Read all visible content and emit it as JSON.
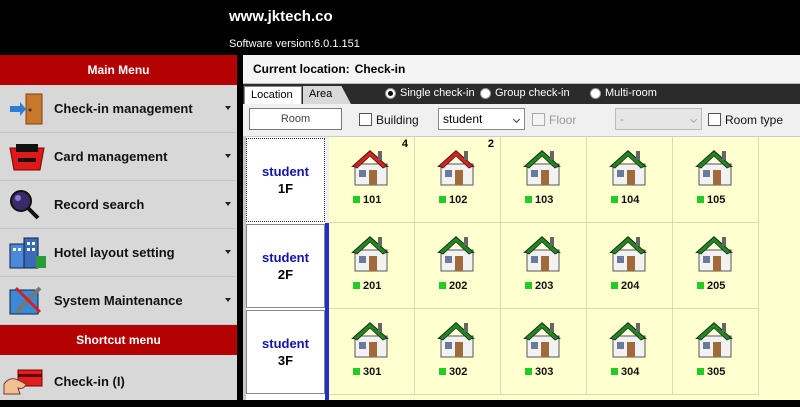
{
  "header": {
    "site": "www.jktech.co",
    "version": "Software version:6.0.1.151"
  },
  "sidebar": {
    "main_menu_title": "Main Menu",
    "items": [
      {
        "label": "Check-in management",
        "icon": "door-icon"
      },
      {
        "label": "Card management",
        "icon": "card-reader-icon"
      },
      {
        "label": "Record search",
        "icon": "magnifier-icon"
      },
      {
        "label": "Hotel layout setting",
        "icon": "building-icon"
      },
      {
        "label": "System Maintenance",
        "icon": "tools-icon"
      }
    ],
    "shortcut_title": "Shortcut menu",
    "shortcut_items": [
      {
        "label": "Check-in (I)",
        "icon": "hand-card-icon"
      }
    ]
  },
  "main": {
    "current_location_label": "Current location:",
    "current_location_value": "Check-in",
    "tabs": [
      {
        "label": "Location",
        "active": true
      },
      {
        "label": "Area",
        "active": false
      }
    ],
    "modes": [
      {
        "label": "Single check-in",
        "selected": true
      },
      {
        "label": "Group check-in",
        "selected": false
      },
      {
        "label": "Multi-room",
        "selected": false
      }
    ],
    "filters": {
      "room_placeholder": "Room",
      "building_label": "Building",
      "building_value": "student",
      "floor_label": "Floor",
      "floor_value": "-",
      "room_type_label": "Room type"
    },
    "floors": [
      {
        "name": "student",
        "floor": "1F",
        "rooms": [
          {
            "number": "101",
            "occupied": true,
            "count": "4"
          },
          {
            "number": "102",
            "occupied": true,
            "count": "2"
          },
          {
            "number": "103",
            "occupied": false,
            "count": ""
          },
          {
            "number": "104",
            "occupied": false,
            "count": ""
          },
          {
            "number": "105",
            "occupied": false,
            "count": ""
          }
        ]
      },
      {
        "name": "student",
        "floor": "2F",
        "rooms": [
          {
            "number": "201",
            "occupied": false,
            "count": ""
          },
          {
            "number": "202",
            "occupied": false,
            "count": ""
          },
          {
            "number": "203",
            "occupied": false,
            "count": ""
          },
          {
            "number": "204",
            "occupied": false,
            "count": ""
          },
          {
            "number": "205",
            "occupied": false,
            "count": ""
          }
        ]
      },
      {
        "name": "student",
        "floor": "3F",
        "rooms": [
          {
            "number": "301",
            "occupied": false,
            "count": ""
          },
          {
            "number": "302",
            "occupied": false,
            "count": ""
          },
          {
            "number": "303",
            "occupied": false,
            "count": ""
          },
          {
            "number": "304",
            "occupied": false,
            "count": ""
          },
          {
            "number": "305",
            "occupied": false,
            "count": ""
          }
        ]
      }
    ]
  },
  "colors": {
    "menu_header": "#b30000",
    "occupied_roof": "#e02020",
    "vacant_roof": "#1e8a1e",
    "status_dot": "#22cc22",
    "grid_bg": "#ffffd0"
  }
}
